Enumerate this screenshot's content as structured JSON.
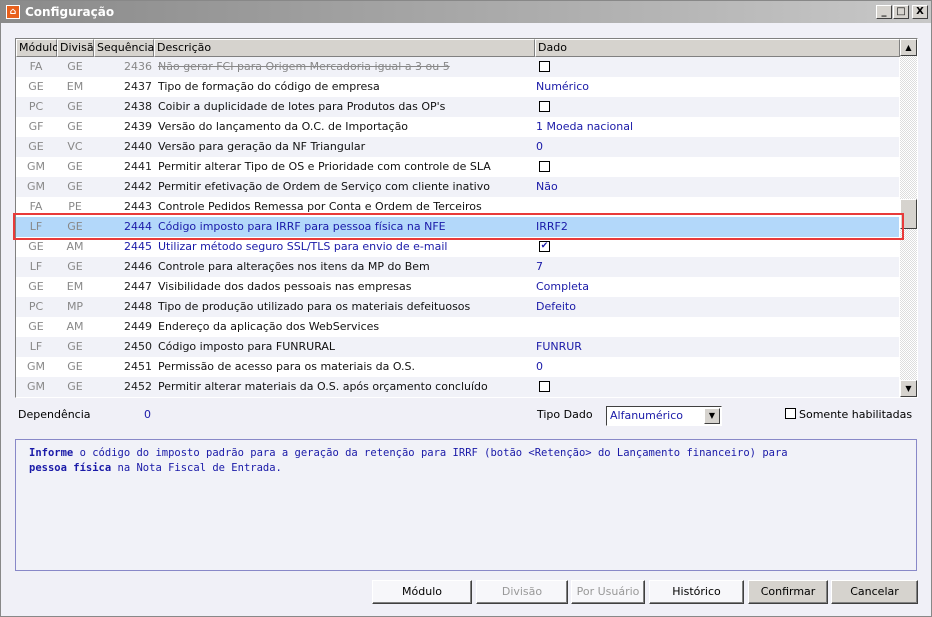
{
  "window": {
    "title": "Configuração",
    "minimize": "_",
    "maximize": "□",
    "close": "X"
  },
  "grid": {
    "headers": [
      "Módulo",
      "Divisão",
      "Sequência",
      "Descrição",
      "Dado"
    ],
    "rows": [
      {
        "modulo": "FA",
        "divisao": "GE",
        "sequencia": "2436",
        "descricao": "Não gerar FCI para Origem Mercadoria igual a 3 ou 5",
        "dado": "",
        "checkbox": false,
        "disabled": true
      },
      {
        "modulo": "GE",
        "divisao": "EM",
        "sequencia": "2437",
        "descricao": "Tipo de formação do código de empresa",
        "dado": "Numérico"
      },
      {
        "modulo": "PC",
        "divisao": "GE",
        "sequencia": "2438",
        "descricao": "Coibir a duplicidade de lotes para Produtos das OP's",
        "dado": "",
        "checkbox": false
      },
      {
        "modulo": "GF",
        "divisao": "GE",
        "sequencia": "2439",
        "descricao": "Versão do lançamento da O.C. de Importação",
        "dado": "1 Moeda nacional"
      },
      {
        "modulo": "GE",
        "divisao": "VC",
        "sequencia": "2440",
        "descricao": "Versão para geração da NF Triangular",
        "dado": "0"
      },
      {
        "modulo": "GM",
        "divisao": "GE",
        "sequencia": "2441",
        "descricao": "Permitir alterar Tipo de OS e Prioridade com controle de SLA",
        "dado": "",
        "checkbox": false
      },
      {
        "modulo": "GM",
        "divisao": "GE",
        "sequencia": "2442",
        "descricao": "Permitir efetivação de Ordem de Serviço com cliente inativo",
        "dado": "Não"
      },
      {
        "modulo": "FA",
        "divisao": "PE",
        "sequencia": "2443",
        "descricao": "Controle Pedidos Remessa por Conta e Ordem de Terceiros",
        "dado": ""
      },
      {
        "modulo": "LF",
        "divisao": "GE",
        "sequencia": "2444",
        "descricao": "Código imposto para IRRF para pessoa física na NFE",
        "dado": "IRRF2",
        "selected": true
      },
      {
        "modulo": "GE",
        "divisao": "AM",
        "sequencia": "2445",
        "descricao": "Utilizar método seguro SSL/TLS para envio de e-mail",
        "dado": "",
        "checkbox": true,
        "highlight": true
      },
      {
        "modulo": "LF",
        "divisao": "GE",
        "sequencia": "2446",
        "descricao": "Controle para alterações nos itens da MP do Bem",
        "dado": "7"
      },
      {
        "modulo": "GE",
        "divisao": "EM",
        "sequencia": "2447",
        "descricao": "Visibilidade dos dados pessoais nas empresas",
        "dado": "Completa"
      },
      {
        "modulo": "PC",
        "divisao": "MP",
        "sequencia": "2448",
        "descricao": "Tipo de produção utilizado para os materiais defeituosos",
        "dado": "Defeito"
      },
      {
        "modulo": "GE",
        "divisao": "AM",
        "sequencia": "2449",
        "descricao": "Endereço da aplicação dos WebServices",
        "dado": ""
      },
      {
        "modulo": "LF",
        "divisao": "GE",
        "sequencia": "2450",
        "descricao": "Código imposto para FUNRURAL",
        "dado": "FUNRUR"
      },
      {
        "modulo": "GM",
        "divisao": "GE",
        "sequencia": "2451",
        "descricao": "Permissão de acesso para os materiais da O.S.",
        "dado": "0"
      },
      {
        "modulo": "GM",
        "divisao": "GE",
        "sequencia": "2452",
        "descricao": "Permitir alterar materiais da O.S. após orçamento concluído",
        "dado": "",
        "checkbox": false
      }
    ],
    "scroll_up": "▲",
    "scroll_down": "▼"
  },
  "details": {
    "dependencia_label": "Dependência",
    "dependencia_value": "0",
    "tipo_dado_label": "Tipo Dado",
    "tipo_dado_value": "Alfanumérico",
    "somente_label": "Somente habilitadas",
    "somente_checked": false
  },
  "info": {
    "bold1": "Informe",
    "text1": " o código do imposto padrão para a geração da retenção para IRRF (botão <Retenção> do Lançamento financeiro) para",
    "bold2": "pessoa física",
    "text2": " na Nota Fiscal de Entrada."
  },
  "buttons": {
    "modulo": "Módulo",
    "divisao": "Divisão",
    "por_usuario": "Por Usuário",
    "historico": "Histórico",
    "confirmar": "Confirmar",
    "cancelar": "Cancelar"
  },
  "colors": {
    "selection": "#b3d8fa",
    "highlight_border": "#e83a3a",
    "data_text": "#1a1aa8"
  }
}
